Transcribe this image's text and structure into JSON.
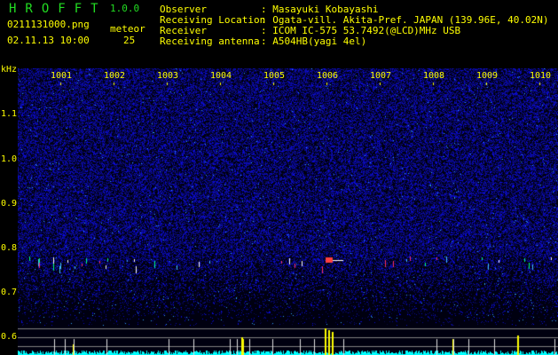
{
  "app": {
    "logo": "HROFFT",
    "version": "1.0.0"
  },
  "file": {
    "name": "0211131000.png",
    "datetime": "02.11.13 10:00"
  },
  "meteor": {
    "label": "meteor",
    "count": "25"
  },
  "info": [
    {
      "label": "Observer",
      "value": ": Masayuki Kobayashi"
    },
    {
      "label": "Receiving Location",
      "value": ": Ogata-vill. Akita-Pref. JAPAN (139.96E, 40.02N)"
    },
    {
      "label": "Receiver",
      "value": ": ICOM IC-575 53.7492(@LCD)MHz USB"
    },
    {
      "label": "Receiving antenna",
      "value": ": A504HB(yagi 4el)"
    }
  ],
  "axis": {
    "y_unit": "kHz",
    "y_ticks": [
      "1.1",
      "1.0",
      "0.9",
      "0.8",
      "0.7",
      "0.6"
    ],
    "x_ticks": [
      "1001",
      "1002",
      "1003",
      "1004",
      "1005",
      "1006",
      "1007",
      "1008",
      "1009",
      "1010"
    ]
  },
  "colors": {
    "text": "#ffff00",
    "logo": "#22dd22",
    "noise": "#2020d0",
    "spectrum": "#00ffff"
  }
}
